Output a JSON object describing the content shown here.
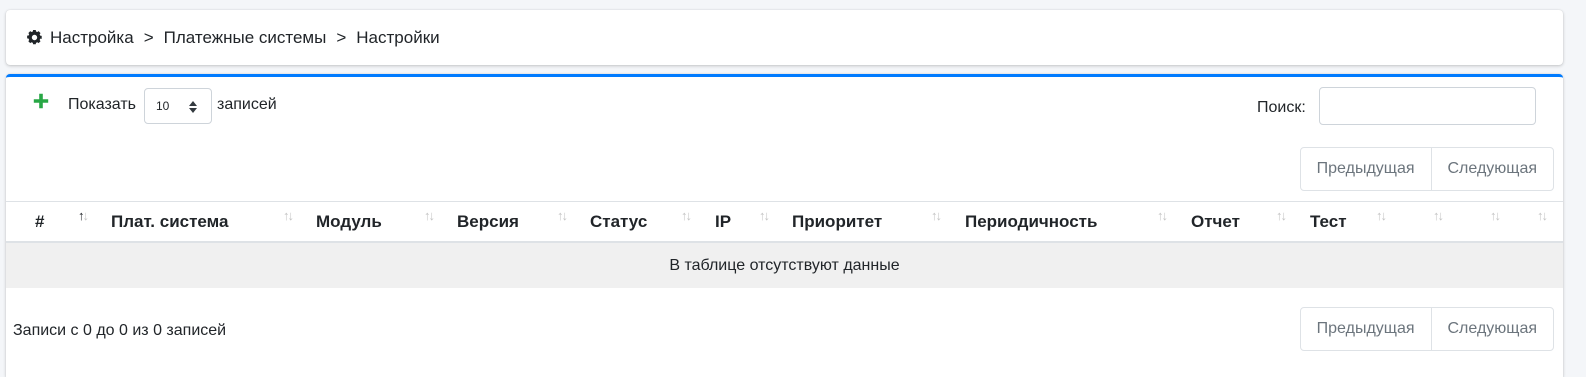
{
  "breadcrumb": {
    "icon": "gear-icon",
    "items": [
      "Настройка",
      "Платежные системы",
      "Настройки"
    ],
    "separator": ">"
  },
  "toolbar": {
    "add_icon": "plus-icon",
    "add_color": "#28a745",
    "show_label": "Показать",
    "length_value": "10",
    "entries_label": "записей",
    "search_label": "Поиск:",
    "search_value": ""
  },
  "pagination": {
    "prev": "Предыдущая",
    "next": "Следующая"
  },
  "table": {
    "columns": [
      "#",
      "Плат. система",
      "Модуль",
      "Версия",
      "Статус",
      "IP",
      "Приоритет",
      "Периодичность",
      "Отчет",
      "Тест",
      "",
      "",
      ""
    ],
    "empty_message": "В таблице отсутствуют данные"
  },
  "info": "Записи с 0 до 0 из 0 записей",
  "colors": {
    "accent": "#007bff",
    "add": "#28a745"
  }
}
